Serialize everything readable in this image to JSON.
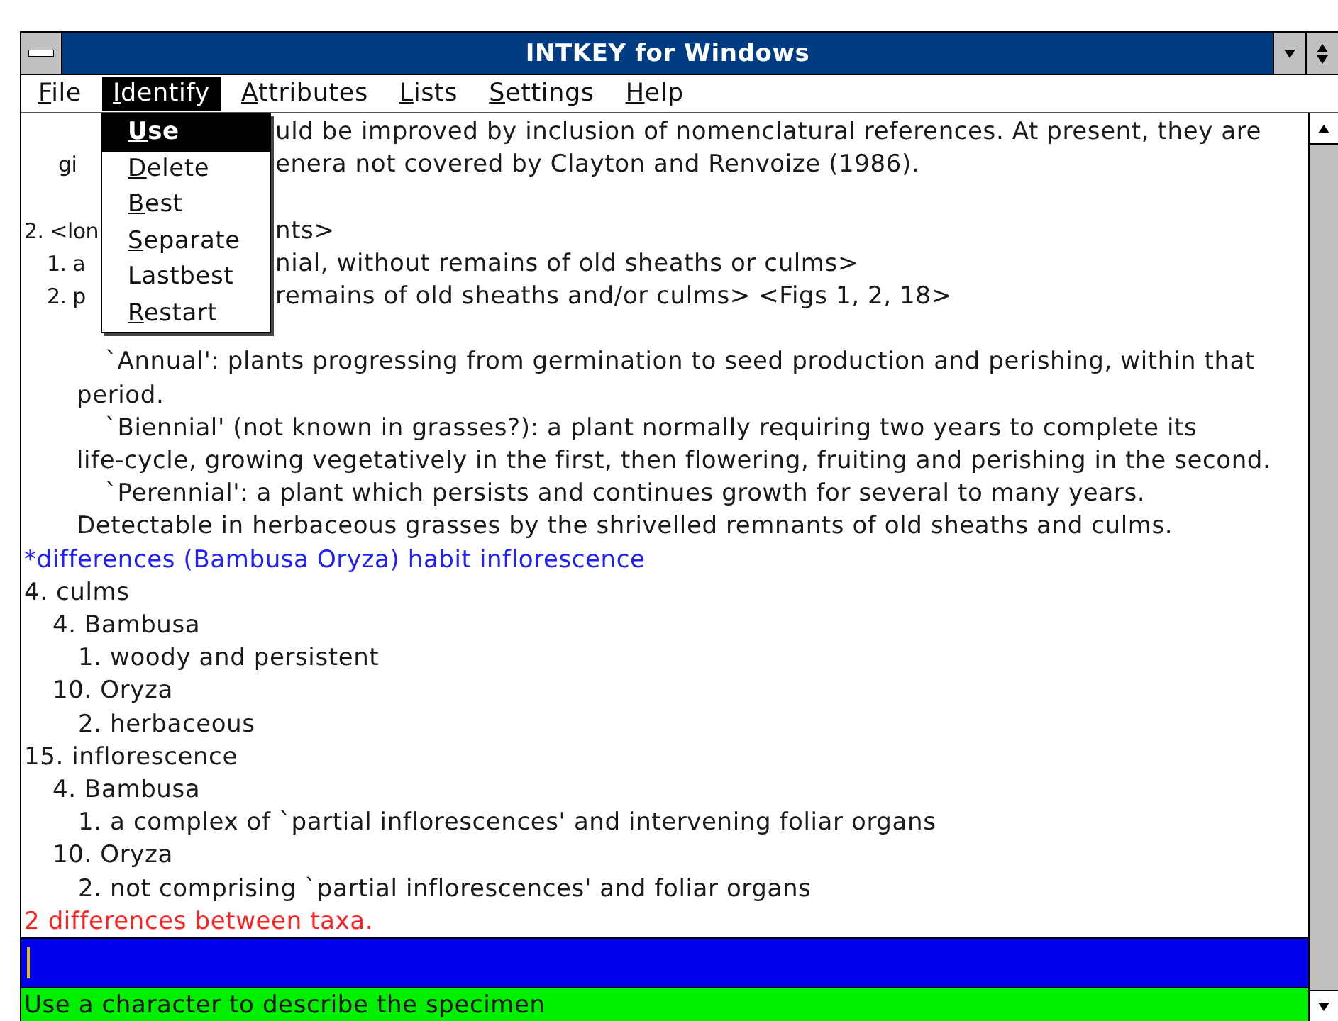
{
  "window": {
    "title": "INTKEY for Windows"
  },
  "menu_bar": [
    {
      "label": "File",
      "mnemonic": true,
      "selected": false
    },
    {
      "label": "Identify",
      "mnemonic": true,
      "selected": true
    },
    {
      "label": "Attributes",
      "mnemonic": true,
      "selected": false
    },
    {
      "label": "Lists",
      "mnemonic": true,
      "selected": false
    },
    {
      "label": "Settings",
      "mnemonic": true,
      "selected": false
    },
    {
      "label": "Help",
      "mnemonic": true,
      "selected": false
    }
  ],
  "open_menu": [
    {
      "label": "Use",
      "mnemonic": true,
      "selected": true
    },
    {
      "label": "Delete",
      "mnemonic": true,
      "selected": false
    },
    {
      "label": "Best",
      "mnemonic": true,
      "selected": false
    },
    {
      "label": "Separate",
      "mnemonic": true,
      "selected": false
    },
    {
      "label": "Lastbest",
      "mnemonic": false,
      "selected": false
    },
    {
      "label": "Restart",
      "mnemonic": true,
      "selected": false
    }
  ],
  "content": [
    {
      "kind": "note",
      "lines": [
        {
          "right": "uld be improved by inclusion of nomenclatural references. At present, they are"
        },
        {
          "left": "gi",
          "right": "enera not covered by Clayton and Renvoize (1986)."
        }
      ]
    },
    {
      "kind": "blank"
    },
    {
      "kind": "occluded_character",
      "left": "2. <lon",
      "right": "nts>",
      "children": [
        {
          "left": "1. a",
          "right": "nial, without remains of old sheaths or culms>"
        },
        {
          "left": "2. p",
          "right": "remains of old sheaths and/or culms> <Figs 1, 2, 18>"
        }
      ]
    },
    {
      "kind": "blank"
    },
    {
      "kind": "definition",
      "lines": [
        "`Annual': plants progressing from germination to seed production and perishing, within that",
        "period."
      ]
    },
    {
      "kind": "definition",
      "lines": [
        "`Biennial' (not known in grasses?): a plant normally requiring two years to complete its",
        "life-cycle, growing vegetatively in the first, then flowering, fruiting and perishing in the second."
      ]
    },
    {
      "kind": "definition",
      "lines": [
        "`Perennial': a plant which persists and continues growth for several to many years.",
        "Detectable in herbaceous grasses by the shrivelled remnants of old sheaths and culms."
      ]
    },
    {
      "kind": "command",
      "text": "*differences (Bambusa Oryza) habit inflorescence"
    },
    {
      "kind": "character",
      "text": "4. culms",
      "children": [
        {
          "text": "4. Bambusa",
          "children": [
            {
              "text": "1. woody and persistent"
            }
          ]
        },
        {
          "text": "10. Oryza",
          "children": [
            {
              "text": "2. herbaceous"
            }
          ]
        }
      ]
    },
    {
      "kind": "character",
      "text": "15. inflorescence",
      "children": [
        {
          "text": "4. Bambusa",
          "children": [
            {
              "text": "1. a complex of `partial inflorescences' and intervening foliar organs"
            }
          ]
        },
        {
          "text": "10. Oryza",
          "children": [
            {
              "text": "2. not comprising `partial inflorescences' and foliar organs"
            }
          ]
        }
      ]
    },
    {
      "kind": "alert",
      "text": "2 differences between taxa."
    }
  ],
  "status_bar": {
    "text": "Use a character to describe the specimen"
  }
}
